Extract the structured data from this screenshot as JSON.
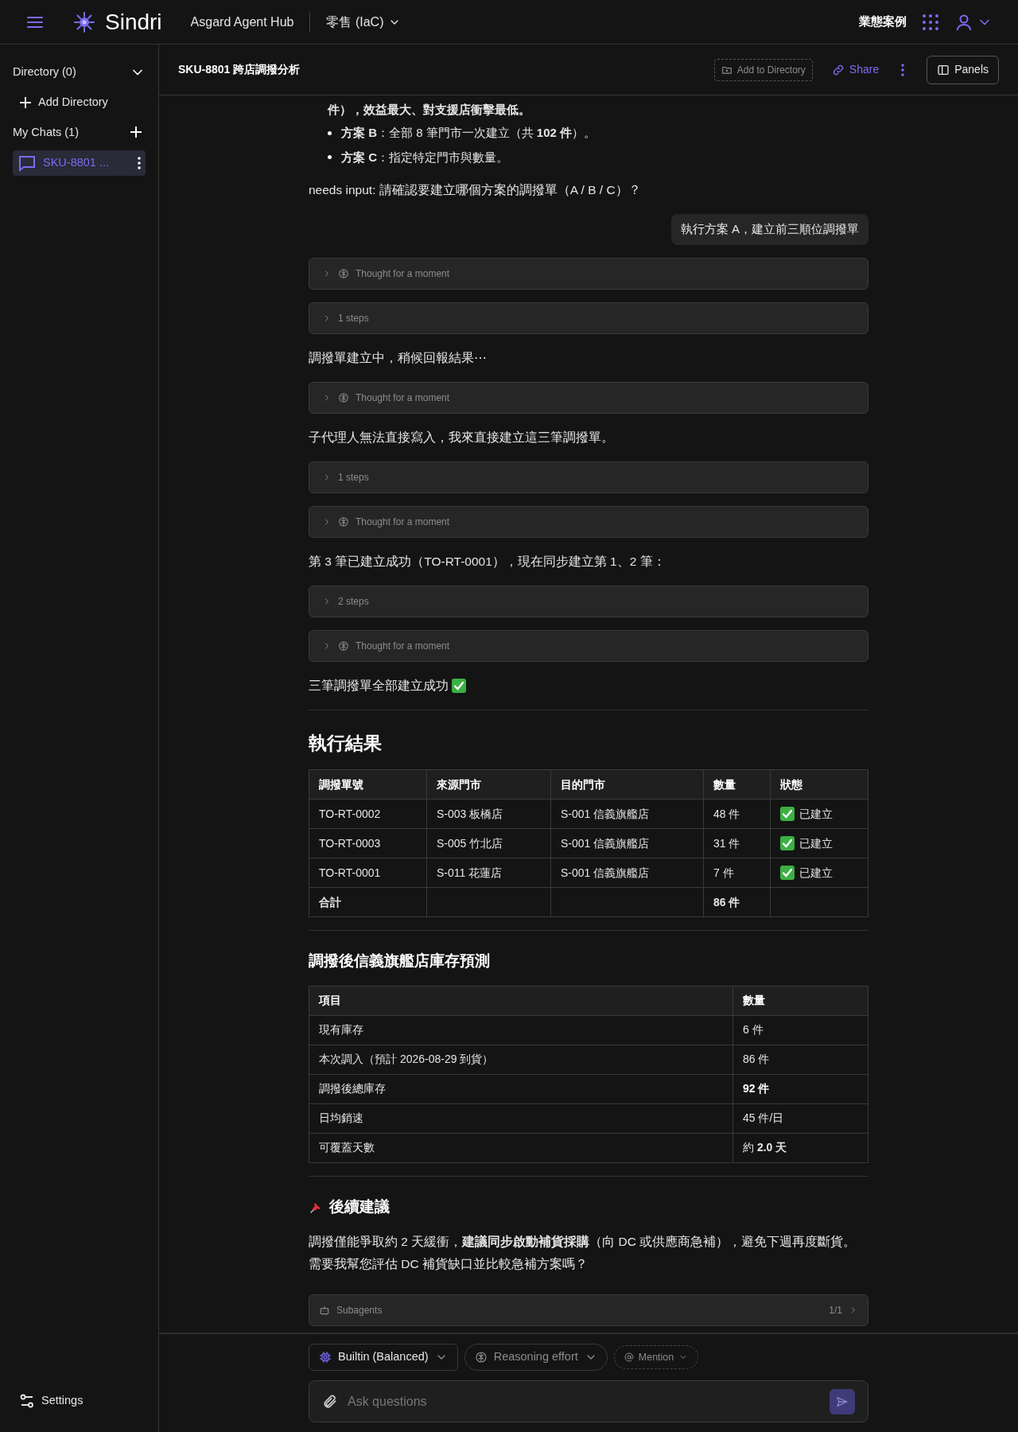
{
  "topbar": {
    "brand": "Sindri",
    "hub": "Asgard Agent Hub",
    "workspace": "零售 (IaC)",
    "right_link": "業態案例"
  },
  "sidebar": {
    "directory": "Directory (0)",
    "add_directory": "Add Directory",
    "chats_label": "My Chats (1)",
    "chats": [
      {
        "title": "SKU-8801 ...",
        "selected": true
      }
    ],
    "settings": "Settings"
  },
  "chat_header": {
    "title": "SKU-8801 跨店調撥分析",
    "add_to_directory": "Add to Directory",
    "share": "Share",
    "panels": "Panels"
  },
  "messages": [
    {
      "kind": "continuation",
      "text": "件），效益最大、對支援店衝擊最低。"
    },
    {
      "kind": "bullet",
      "text": "**方案 B**：全部 8 筆門市一次建立（共 **102 件**）。"
    },
    {
      "kind": "bullet",
      "text": "**方案 C**：指定特定門市與數量。"
    },
    {
      "kind": "text",
      "text": "needs input: 請確認要建立哪個方案的調撥單（A / B / C）？"
    },
    {
      "kind": "user",
      "text": "執行方案 A，建立前三順位調撥單"
    },
    {
      "kind": "thought",
      "label": "Thought for a moment",
      "expanded": false
    },
    {
      "kind": "steps",
      "label": "1 steps",
      "expanded": false
    },
    {
      "kind": "text",
      "text": "調撥單建立中，稍候回報結果⋯"
    },
    {
      "kind": "thought",
      "label": "Thought for a moment",
      "expanded": false
    },
    {
      "kind": "text",
      "text": "子代理人無法直接寫入，我來直接建立這三筆調撥單。"
    },
    {
      "kind": "steps",
      "label": "1 steps",
      "expanded": false
    },
    {
      "kind": "thought",
      "label": "Thought for a moment",
      "expanded": false
    },
    {
      "kind": "text",
      "text": "第 3 筆已建立成功（TO-RT-0001），現在同步建立第 1、2 筆："
    },
    {
      "kind": "steps",
      "label": "2 steps",
      "expanded": false
    },
    {
      "kind": "thought",
      "label": "Thought for a moment",
      "expanded": false
    },
    {
      "kind": "text",
      "text": "三筆調撥單全部建立成功",
      "check": true
    },
    {
      "kind": "rule"
    },
    {
      "kind": "h2",
      "text": "執行結果"
    },
    {
      "kind": "transfer_table",
      "columns": [
        "調撥單號",
        "來源門市",
        "目的門市",
        "數量",
        "狀態"
      ],
      "rows": [
        {
          "id": "TO-RT-0002",
          "source": "S-003 板橋店",
          "target": "S-001 信義旗艦店",
          "quantity": "48 件",
          "status": "已建立",
          "done": true
        },
        {
          "id": "TO-RT-0003",
          "source": "S-005 竹北店",
          "target": "S-001 信義旗艦店",
          "quantity": "31 件",
          "status": "已建立",
          "done": true
        },
        {
          "id": "TO-RT-0001",
          "source": "S-011 花蓮店",
          "target": "S-001 信義旗艦店",
          "quantity": "7 件",
          "status": "已建立",
          "done": true
        }
      ],
      "total": {
        "label": "合計",
        "quantity": "86 件"
      }
    },
    {
      "kind": "rule"
    },
    {
      "kind": "h3",
      "text": "調撥後信義旗艦店庫存預測",
      "pinned": false
    },
    {
      "kind": "forecast_table",
      "columns": [
        "項目",
        "數量"
      ],
      "rows": [
        {
          "item": "現有庫存",
          "value": "6 件",
          "value_bold": false
        },
        {
          "item": "本次調入（預計 2026-08-29 到貨）",
          "value": "86 件",
          "value_bold": false
        },
        {
          "item": "調撥後總庫存",
          "value": "92 件",
          "value_bold": true
        },
        {
          "item": "日均銷速",
          "value": "45 件/日",
          "value_bold": false
        },
        {
          "item": "可覆蓋天數",
          "value": "約 **2.0 天**",
          "value_bold": false
        }
      ]
    },
    {
      "kind": "rule"
    },
    {
      "kind": "h3",
      "text": "後續建議",
      "pinned": true
    },
    {
      "kind": "text",
      "text": "調撥僅能爭取約 2 天緩衝，**建議同步啟動補貨採購**（向 DC 或供應商急補），避免下週再度斷貨。需要我幫您評估 DC 補貨缺口並比較急補方案嗎？"
    },
    {
      "kind": "subagents",
      "label": "Subagents",
      "count": "1/1"
    }
  ],
  "composer": {
    "model": "Builtin (Balanced)",
    "reasoning": "Reasoning effort",
    "mention": "Mention",
    "placeholder": "Ask questions"
  }
}
